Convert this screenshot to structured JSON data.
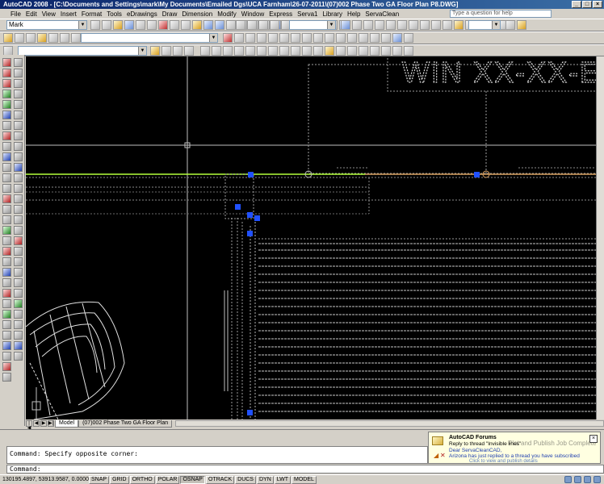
{
  "window": {
    "title": "AutoCAD 2008 - [C:\\Documents and Settings\\mark\\My Documents\\Emailed Dgs\\UCA Farnham\\26-07-2011\\(07)002 Phase Two GA Floor Plan P8.DWG]",
    "minimize": "_",
    "maximize": "□",
    "close": "×"
  },
  "menu": {
    "items": [
      "File",
      "Edit",
      "View",
      "Insert",
      "Format",
      "Tools",
      "eDrawings",
      "Draw",
      "Dimension",
      "Modify",
      "Window",
      "Express",
      "Serva1",
      "Library",
      "Help",
      "ServaClean"
    ],
    "help_placeholder": "Type a question for help"
  },
  "toolbar": {
    "workspace": "Mark",
    "layer": ""
  },
  "drawing": {
    "title_text": "WIN XX-XX-E",
    "background": "#000000",
    "accent_green": "#b4ff3c",
    "accent_orange": "#d8a060",
    "grip_blue": "#2050ff"
  },
  "layout_tabs": {
    "nav": [
      "|◀",
      "◀",
      "▶",
      "▶|"
    ],
    "tabs": [
      "Model",
      "(07)002 Phase Two GA Floor Plan"
    ]
  },
  "command": {
    "history": "Command: Specify opposite corner:",
    "prompt": "Command:"
  },
  "status": {
    "coords": "130195.4897, 53913.9587, 0.0000",
    "buttons": [
      "SNAP",
      "GRID",
      "ORTHO",
      "POLAR",
      "OSNAP",
      "OTRACK",
      "DUCS",
      "DYN",
      "LWT",
      "MODEL"
    ],
    "active": [
      "OSNAP"
    ]
  },
  "notification": {
    "title": "AutoCAD Forums",
    "subtitle": "Reply to thread \"Invisible lines\"",
    "line1": "Dear ServaCleanCAD,",
    "line2": "Arizona has just replied to a thread you have subscribed",
    "line3": "Click to view and publish details",
    "ghost": "Plot and Publish Job Complete",
    "close": "×"
  }
}
